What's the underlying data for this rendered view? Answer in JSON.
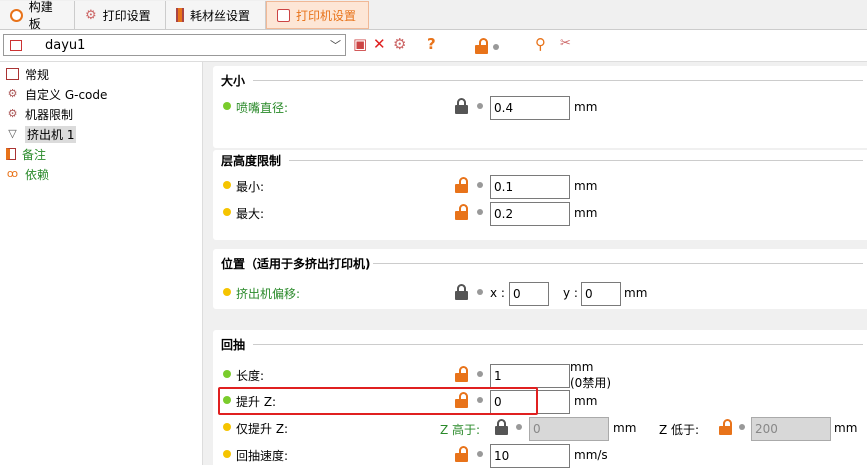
{
  "tabs": [
    {
      "label": "构建板",
      "icon": "build-plate-icon"
    },
    {
      "label": "打印设置",
      "icon": "print-settings-icon"
    },
    {
      "label": "耗材丝设置",
      "icon": "filament-icon"
    },
    {
      "label": "打印机设置",
      "icon": "printer-icon",
      "active": true
    }
  ],
  "preset": {
    "name": "dayu1"
  },
  "toolbar": {
    "question": "?"
  },
  "tree": [
    {
      "label": "常规",
      "icon": "general-icon",
      "color": "#000"
    },
    {
      "label": "自定义 G-code",
      "icon": "gcode-icon",
      "color": "#000"
    },
    {
      "label": "机器限制",
      "icon": "machine-limits-icon",
      "color": "#000"
    },
    {
      "label": "挤出机 1",
      "icon": "extruder-icon",
      "color": "#000",
      "selected": true
    },
    {
      "label": "备注",
      "icon": "notes-icon",
      "color": "#2a8a2a"
    },
    {
      "label": "依赖",
      "icon": "dependencies-icon",
      "color": "#2a8a2a"
    }
  ],
  "groups": {
    "size": {
      "title": "大小",
      "nozzle_label": "喷嘴直径:",
      "nozzle_value": "0.4",
      "unit": "mm"
    },
    "layer": {
      "title": "层高度限制",
      "min_label": "最小:",
      "min_value": "0.1",
      "max_label": "最大:",
      "max_value": "0.2",
      "unit": "mm"
    },
    "position": {
      "title": "位置（适用于多挤出打印机)",
      "offset_label": "挤出机偏移:",
      "x_label": "x :",
      "x_value": "0",
      "y_label": "y :",
      "y_value": "0",
      "unit": "mm"
    },
    "retract": {
      "title": "回抽",
      "length_label": "长度:",
      "length_value": "1",
      "length_unit": "mm",
      "length_note": "(0禁用)",
      "lift_label": "提升 Z:",
      "lift_value": "0",
      "lift_unit": "mm",
      "only_lift_label": "仅提升 Z:",
      "above_label": "Z 高于:",
      "above_value": "0",
      "above_unit": "mm",
      "below_label": "Z 低于:",
      "below_value": "200",
      "below_unit": "mm",
      "speed_label": "回抽速度:",
      "speed_value": "10",
      "speed_unit": "mm/s"
    }
  }
}
